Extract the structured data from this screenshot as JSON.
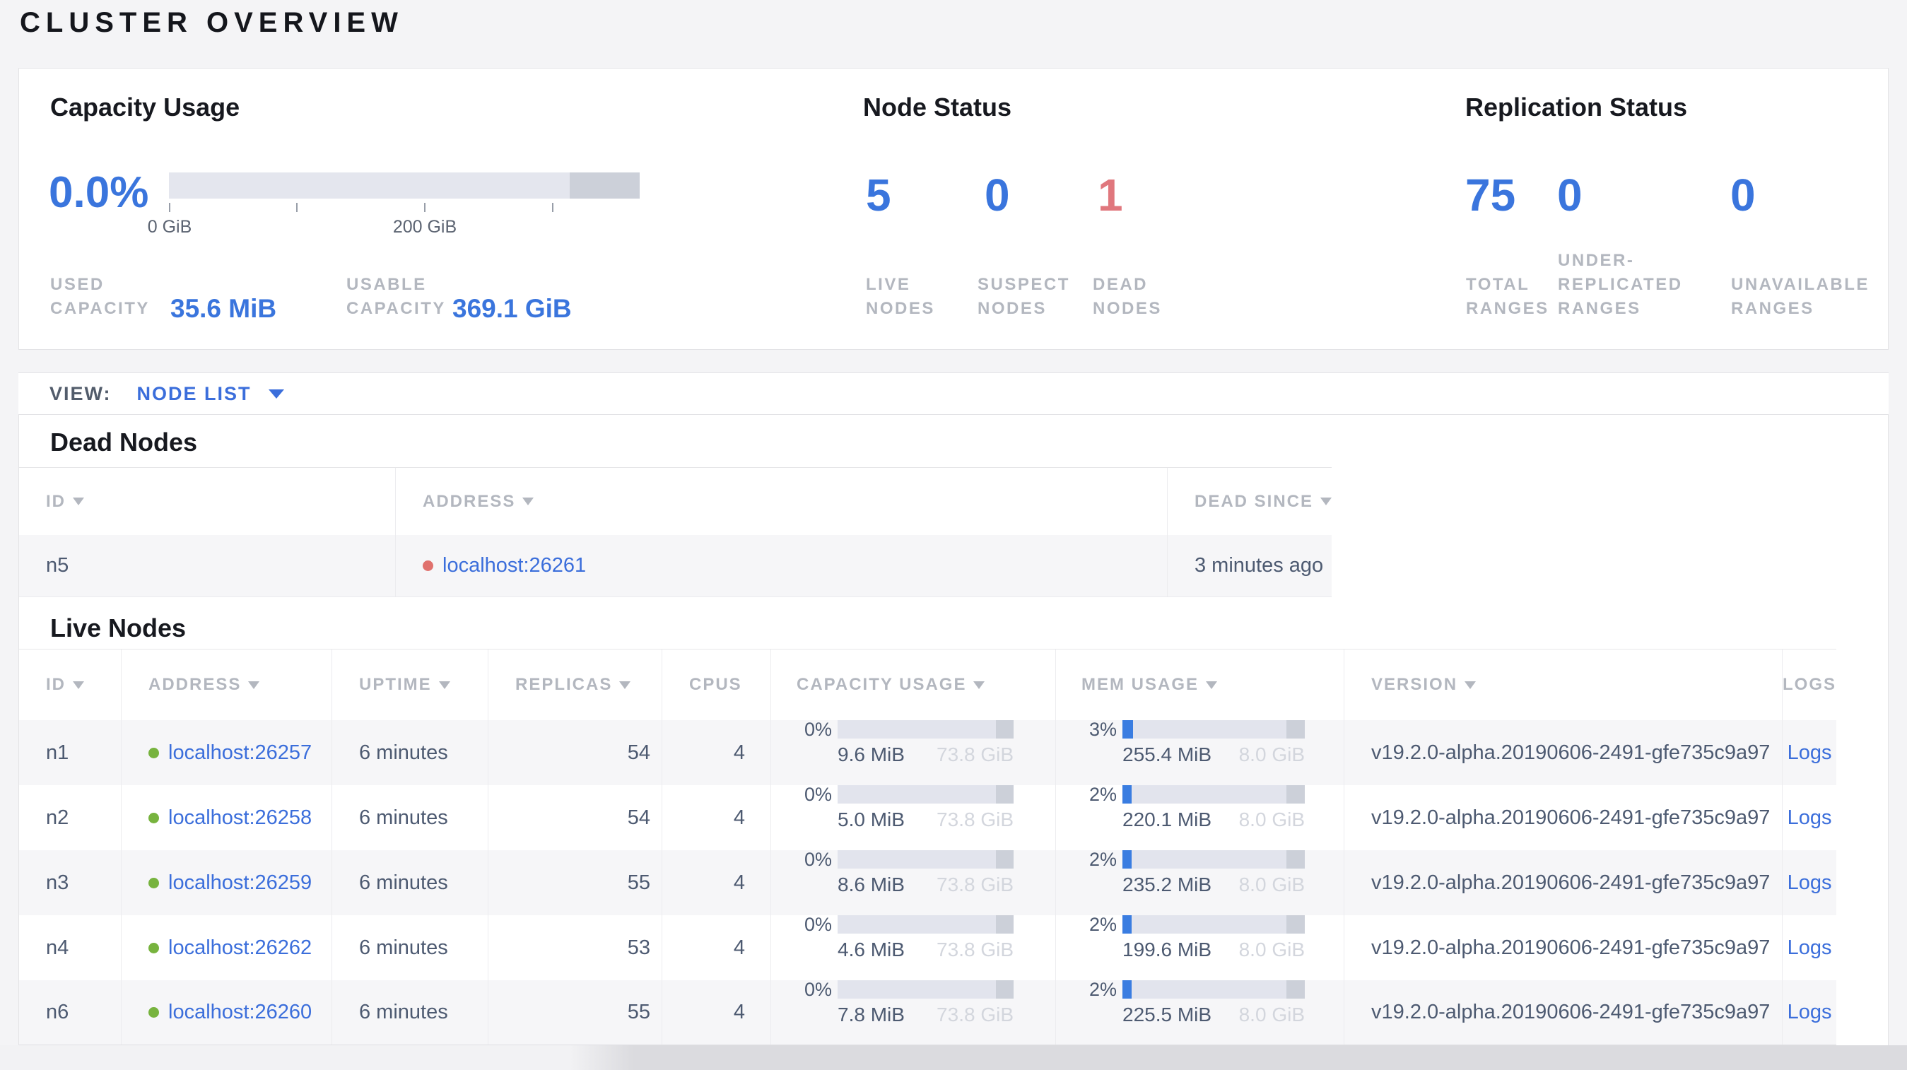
{
  "page_title": "CLUSTER OVERVIEW",
  "colors": {
    "accent_blue": "#3a75dd",
    "link_blue": "#3b6edb",
    "dead_red": "#e0777d",
    "live_dot_green": "#77b33e",
    "dead_dot_red": "#e0716d",
    "bar_track": "#e2e4ed",
    "bar_endcap": "#ccd0d9",
    "bar_fill_blue": "#3a7de1"
  },
  "summary": {
    "capacity": {
      "title": "Capacity Usage",
      "percent": "0.0%",
      "tick_0": "0 GiB",
      "tick_200": "200 GiB",
      "used_label": "USED CAPACITY",
      "used_value": "35.6 MiB",
      "usable_label": "USABLE CAPACITY",
      "usable_value": "369.1 GiB"
    },
    "node_status": {
      "title": "Node Status",
      "live": {
        "value": "5",
        "label": "LIVE NODES"
      },
      "suspect": {
        "value": "0",
        "label": "SUSPECT NODES"
      },
      "dead": {
        "value": "1",
        "label": "DEAD NODES"
      }
    },
    "replication": {
      "title": "Replication Status",
      "total": {
        "value": "75",
        "label": "TOTAL RANGES"
      },
      "under_replicated": {
        "value": "0",
        "label": "UNDER-REPLICATED RANGES"
      },
      "unavailable": {
        "value": "0",
        "label": "UNAVAILABLE RANGES"
      }
    }
  },
  "view_bar": {
    "label": "VIEW:",
    "selected": "NODE LIST"
  },
  "dead": {
    "title": "Dead Nodes",
    "headers": {
      "id": "ID",
      "address": "ADDRESS",
      "dead_since": "DEAD SINCE"
    },
    "rows": [
      {
        "id": "n5",
        "address": "localhost:26261",
        "dead_since": "3 minutes ago"
      }
    ]
  },
  "live": {
    "title": "Live Nodes",
    "headers": {
      "id": "ID",
      "address": "ADDRESS",
      "uptime": "UPTIME",
      "replicas": "REPLICAS",
      "cpus": "CPUS",
      "capacity": "CAPACITY USAGE",
      "mem": "MEM USAGE",
      "version": "VERSION",
      "logs": "LOGS"
    },
    "rows": [
      {
        "id": "n1",
        "address": "localhost:26257",
        "uptime": "6 minutes",
        "replicas": "54",
        "cpus": "4",
        "capacity": {
          "percent": "0%",
          "used": "9.6 MiB",
          "total": "73.8 GiB",
          "fill_width": "0%"
        },
        "mem": {
          "percent": "3%",
          "used": "255.4 MiB",
          "total": "8.0 GiB",
          "fill_width": "6%"
        },
        "version": "v19.2.0-alpha.20190606-2491-gfe735c9a97",
        "logs_label": "Logs"
      },
      {
        "id": "n2",
        "address": "localhost:26258",
        "uptime": "6 minutes",
        "replicas": "54",
        "cpus": "4",
        "capacity": {
          "percent": "0%",
          "used": "5.0 MiB",
          "total": "73.8 GiB",
          "fill_width": "0%"
        },
        "mem": {
          "percent": "2%",
          "used": "220.1 MiB",
          "total": "8.0 GiB",
          "fill_width": "5%"
        },
        "version": "v19.2.0-alpha.20190606-2491-gfe735c9a97",
        "logs_label": "Logs"
      },
      {
        "id": "n3",
        "address": "localhost:26259",
        "uptime": "6 minutes",
        "replicas": "55",
        "cpus": "4",
        "capacity": {
          "percent": "0%",
          "used": "8.6 MiB",
          "total": "73.8 GiB",
          "fill_width": "0%"
        },
        "mem": {
          "percent": "2%",
          "used": "235.2 MiB",
          "total": "8.0 GiB",
          "fill_width": "5%"
        },
        "version": "v19.2.0-alpha.20190606-2491-gfe735c9a97",
        "logs_label": "Logs"
      },
      {
        "id": "n4",
        "address": "localhost:26262",
        "uptime": "6 minutes",
        "replicas": "53",
        "cpus": "4",
        "capacity": {
          "percent": "0%",
          "used": "4.6 MiB",
          "total": "73.8 GiB",
          "fill_width": "0%"
        },
        "mem": {
          "percent": "2%",
          "used": "199.6 MiB",
          "total": "8.0 GiB",
          "fill_width": "5%"
        },
        "version": "v19.2.0-alpha.20190606-2491-gfe735c9a97",
        "logs_label": "Logs"
      },
      {
        "id": "n6",
        "address": "localhost:26260",
        "uptime": "6 minutes",
        "replicas": "55",
        "cpus": "4",
        "capacity": {
          "percent": "0%",
          "used": "7.8 MiB",
          "total": "73.8 GiB",
          "fill_width": "0%"
        },
        "mem": {
          "percent": "2%",
          "used": "225.5 MiB",
          "total": "8.0 GiB",
          "fill_width": "5%"
        },
        "version": "v19.2.0-alpha.20190606-2491-gfe735c9a97",
        "logs_label": "Logs"
      }
    ]
  }
}
